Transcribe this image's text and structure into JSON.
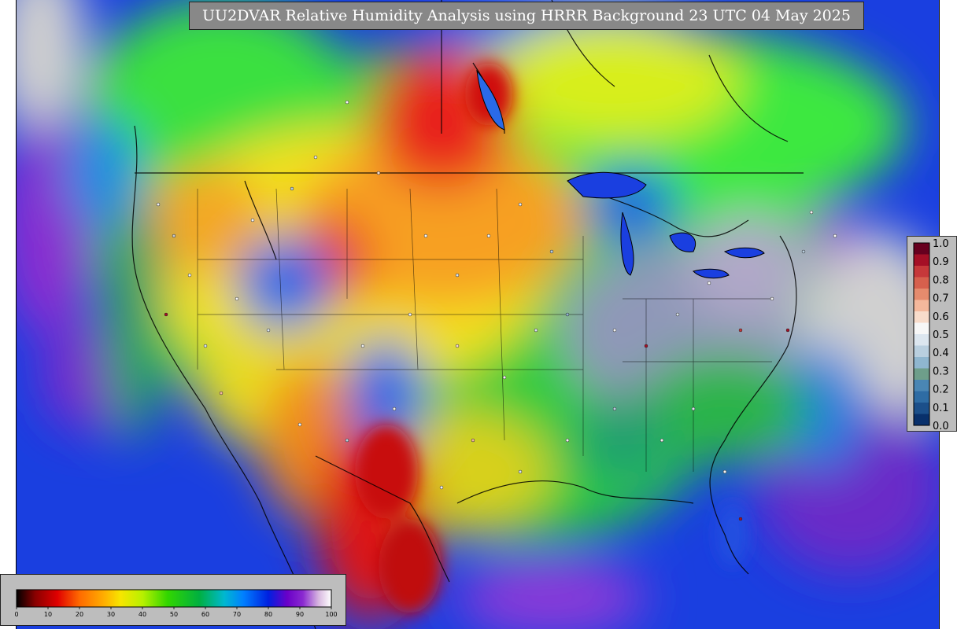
{
  "title": "UU2DVAR Relative Humidity Analysis using HRRR Background 23 UTC 04 May 2025",
  "rh_colorbar": {
    "ticks": [
      "0",
      "10",
      "20",
      "30",
      "40",
      "50",
      "60",
      "70",
      "80",
      "90",
      "100"
    ]
  },
  "obs_colorbar": {
    "ticks": [
      "1.0",
      "0.9",
      "0.8",
      "0.7",
      "0.6",
      "0.5",
      "0.4",
      "0.3",
      "0.2",
      "0.1",
      "0.0"
    ],
    "colors": [
      "#67001f",
      "#a50f26",
      "#c6383a",
      "#d6604d",
      "#e58b6d",
      "#f4b89c",
      "#f8dccb",
      "#f7f7f7",
      "#dce6ef",
      "#b9cfdf",
      "#8fb6cf",
      "#6e9e8a",
      "#4a86b4",
      "#2e6ca4",
      "#1b4f8a",
      "#08306b"
    ]
  }
}
